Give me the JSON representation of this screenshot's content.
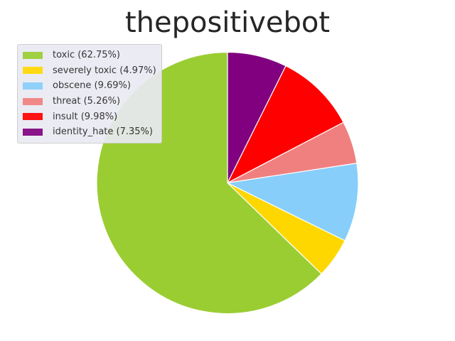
{
  "chart_data": {
    "type": "pie",
    "title": "thepositivebot",
    "start_angle_deg": 90,
    "direction": "clockwise",
    "slices": [
      {
        "label": "identity_hate (7.35%)",
        "value": 7.35,
        "color": "#800080"
      },
      {
        "label": "insult (9.98%)",
        "value": 9.98,
        "color": "#ff0000"
      },
      {
        "label": "threat (5.26%)",
        "value": 5.26,
        "color": "#f08080"
      },
      {
        "label": "obscene (9.69%)",
        "value": 9.69,
        "color": "#87cefa"
      },
      {
        "label": "severely toxic (4.97%)",
        "value": 4.97,
        "color": "#ffd700"
      },
      {
        "label": "toxic (62.75%)",
        "value": 62.75,
        "color": "#9acd32"
      }
    ],
    "legend": {
      "position": "upper-left",
      "entries": [
        {
          "label": "toxic (62.75%)",
          "color": "#9acd32"
        },
        {
          "label": "severely toxic (4.97%)",
          "color": "#ffd700"
        },
        {
          "label": "obscene (9.69%)",
          "color": "#87cefa"
        },
        {
          "label": "threat (5.26%)",
          "color": "#f08080"
        },
        {
          "label": "insult (9.98%)",
          "color": "#ff0000"
        },
        {
          "label": "identity_hate (7.35%)",
          "color": "#800080"
        }
      ]
    },
    "wedge_edge_color": "#ffffff"
  }
}
